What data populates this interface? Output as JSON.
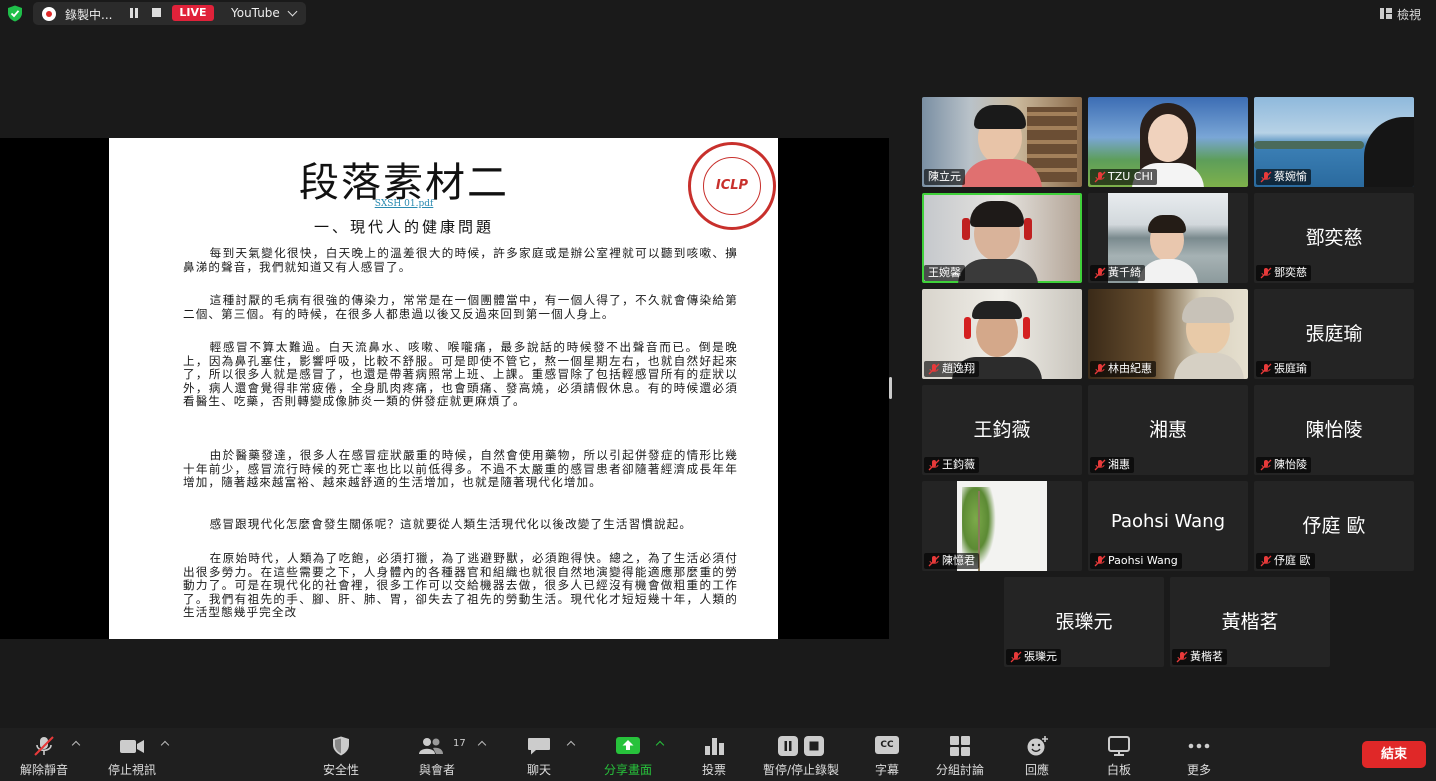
{
  "topbar": {
    "recording_label": "錄製中...",
    "live_badge": "LIVE",
    "stream_target": "YouTube",
    "view_label": "檢視"
  },
  "document": {
    "title": "段落素材二",
    "file_link": "SXSH 01.pdf",
    "subtitle": "一、現代人的健康問題",
    "seal_text": "ICLP",
    "paragraphs": [
      "每到天氣變化很快，白天晚上的溫差很大的時候，許多家庭或是辦公室裡就可以聽到咳嗽、擤鼻涕的聲音，我們就知道又有人感冒了。",
      "這種討厭的毛病有很強的傳染力，常常是在一個團體當中，有一個人得了，不久就會傳染給第二個、第三個。有的時候，在很多人都患過以後又反過來回到第一個人身上。",
      "輕感冒不算太難過。白天流鼻水、咳嗽、喉嚨痛，最多說話的時候發不出聲音而已。倒是晚上，因為鼻孔塞住，影響呼吸，比較不舒服。可是即使不管它，熬一個星期左右，也就自然好起來了，所以很多人就是感冒了，也還是帶著病照常上班、上課。重感冒除了包括輕感冒所有的症狀以外，病人還會覺得非常疲倦，全身肌肉疼痛，也會頭痛、發高燒，必須請假休息。有的時候還必須看醫生、吃藥，否則轉變成像肺炎一類的併發症就更麻煩了。",
      "由於醫藥發達，很多人在感冒症狀嚴重的時候，自然會使用藥物，所以引起併發症的情形比幾十年前少，感冒流行時候的死亡率也比以前低得多。不過不太嚴重的感冒患者卻隨著經濟成長年年增加，隨著越來越富裕、越來越舒適的生活增加，也就是隨著現代化增加。",
      "感冒跟現代化怎麼會發生關係呢？這就要從人類生活現代化以後改變了生活習慣說起。",
      "在原始時代，人類為了吃飽，必須打獵，為了逃避野獸，必須跑得快。總之，為了生活必須付出很多勞力。在這些需要之下，人身體內的各種器官和組織也就很自然地演變得能適應那麼重的勞動力了。可是在現代化的社會裡，很多工作可以交給機器去做，很多人已經沒有機會做粗重的工作了。我們有祖先的手、腳、肝、肺、胃，卻失去了祖先的勞動生活。現代化才短短幾十年，人類的生活型態幾乎完全改"
    ]
  },
  "participants": [
    {
      "name": "陳立元",
      "muted": false,
      "video": true
    },
    {
      "name": "TZU CHI",
      "muted": true,
      "video": true
    },
    {
      "name": "蔡婉愉",
      "muted": true,
      "video": true
    },
    {
      "name": "王婉馨",
      "muted": false,
      "video": true,
      "active": true
    },
    {
      "name": "黃千綺",
      "muted": true,
      "video": true
    },
    {
      "name": "鄧奕慈",
      "muted": true,
      "video": false
    },
    {
      "name": "趙逸翔",
      "muted": true,
      "video": true
    },
    {
      "name": "林由紀惠",
      "muted": true,
      "video": true
    },
    {
      "name": "張庭瑜",
      "muted": true,
      "video": false
    },
    {
      "name": "王鈞薇",
      "muted": true,
      "video": false
    },
    {
      "name": "湘惠",
      "muted": true,
      "video": false
    },
    {
      "name": "陳怡陵",
      "muted": true,
      "video": false
    },
    {
      "name": "陳憶君",
      "muted": true,
      "video": true
    },
    {
      "name": "Paohsi Wang",
      "muted": true,
      "video": false
    },
    {
      "name": "伃庭 歐",
      "muted": true,
      "video": false
    },
    {
      "name": "張瓅元",
      "muted": true,
      "video": false
    },
    {
      "name": "黃楷茗",
      "muted": true,
      "video": false
    }
  ],
  "toolbar": {
    "unmute": "解除靜音",
    "stop_video": "停止視訊",
    "security": "安全性",
    "participants": "與會者",
    "participants_count": "17",
    "chat": "聊天",
    "share_screen": "分享畫面",
    "polls": "投票",
    "pause_recording": "暫停/停止錄製",
    "captions": "字幕",
    "cc_icon_text": "CC",
    "breakout": "分組討論",
    "reactions": "回應",
    "whiteboard": "白板",
    "more": "更多",
    "end": "結束"
  },
  "colors": {
    "live_red": "#e0223a",
    "share_green": "#27c23b",
    "active_speaker": "#3fd13a",
    "end_red": "#e02828"
  }
}
